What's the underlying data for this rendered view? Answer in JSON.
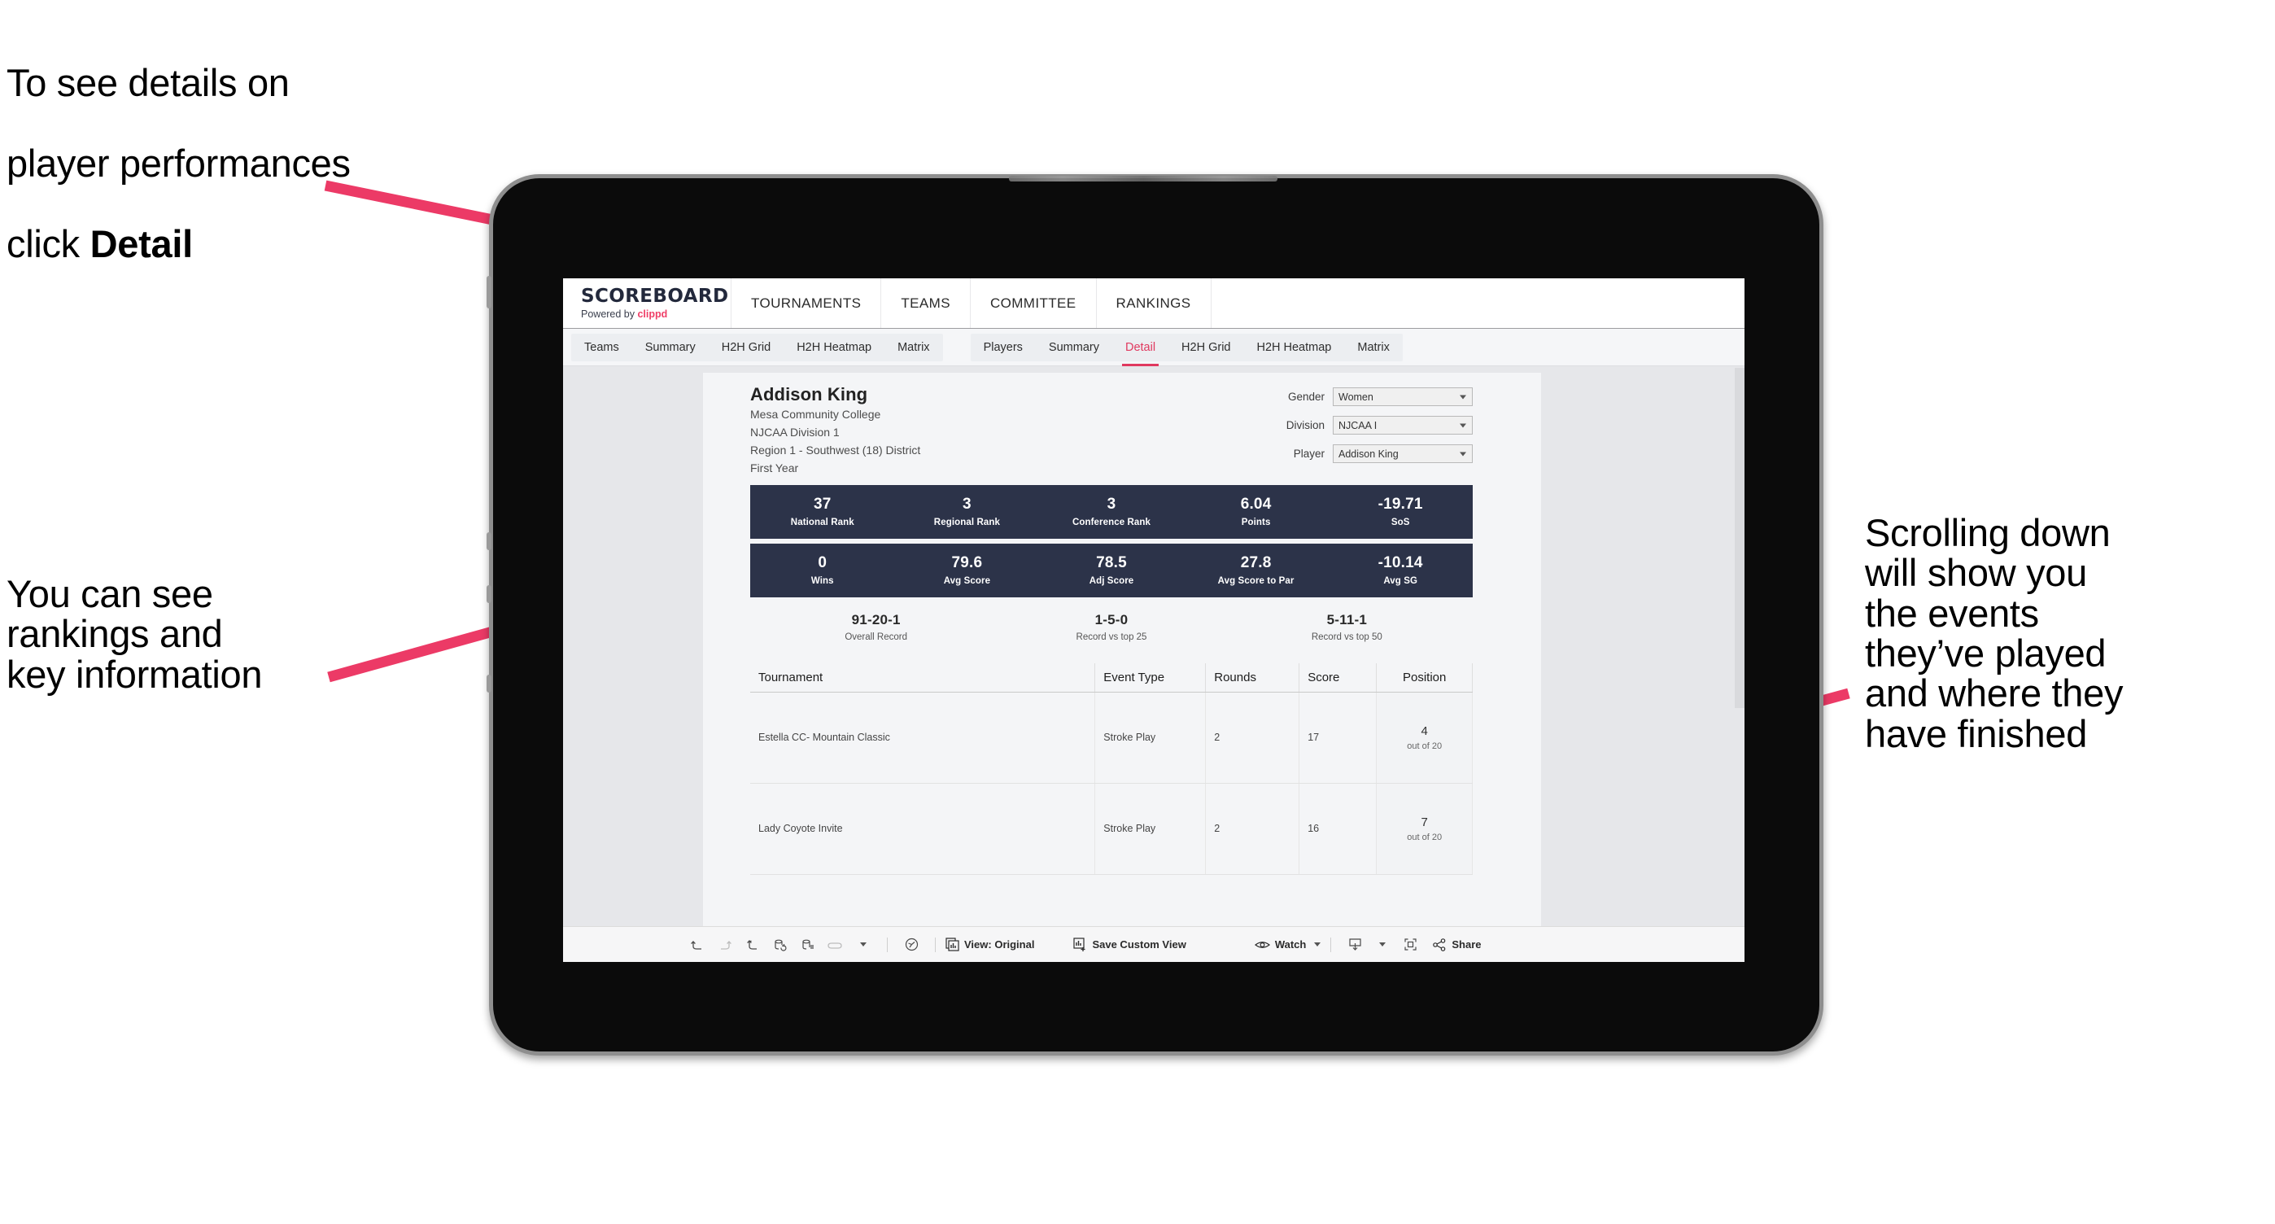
{
  "annotations": {
    "detail_note_line1": "To see details on",
    "detail_note_line2": "player performances",
    "detail_note_line3_prefix": "click ",
    "detail_note_line3_bold": "Detail",
    "rankings_note": "You can see\nrankings and\nkey information",
    "scroll_note": "Scrolling down\nwill show you\nthe events\nthey’ve played\nand where they\nhave finished",
    "accent_color": "#ec3a66"
  },
  "app": {
    "brand": {
      "title": "SCOREBOARD",
      "powered_prefix": "Powered by ",
      "powered_name": "clippd"
    },
    "top_nav": [
      "TOURNAMENTS",
      "TEAMS",
      "COMMITTEE",
      "RANKINGS"
    ],
    "tabs_group_one": [
      "Teams",
      "Summary",
      "H2H Grid",
      "H2H Heatmap",
      "Matrix"
    ],
    "tabs_group_two": [
      "Players",
      "Summary",
      "Detail",
      "H2H Grid",
      "H2H Heatmap",
      "Matrix"
    ],
    "active_tab": "Detail",
    "active_tab_color": "#e0395f"
  },
  "player": {
    "name": "Addison King",
    "school": "Mesa Community College",
    "division": "NJCAA Division 1",
    "region": "Region 1 - Southwest (18) District",
    "year": "First Year"
  },
  "filters": [
    {
      "label": "Gender",
      "value": "Women"
    },
    {
      "label": "Division",
      "value": "NJCAA I"
    },
    {
      "label": "Player",
      "value": "Addison King"
    }
  ],
  "stats_row_one": [
    {
      "value": "37",
      "label": "National Rank"
    },
    {
      "value": "3",
      "label": "Regional Rank"
    },
    {
      "value": "3",
      "label": "Conference Rank"
    },
    {
      "value": "6.04",
      "label": "Points"
    },
    {
      "value": "-19.71",
      "label": "SoS"
    }
  ],
  "stats_row_two": [
    {
      "value": "0",
      "label": "Wins"
    },
    {
      "value": "79.6",
      "label": "Avg Score"
    },
    {
      "value": "78.5",
      "label": "Adj Score"
    },
    {
      "value": "27.8",
      "label": "Avg Score to Par"
    },
    {
      "value": "-10.14",
      "label": "Avg SG"
    }
  ],
  "records": [
    {
      "value": "91-20-1",
      "label": "Overall Record"
    },
    {
      "value": "1-5-0",
      "label": "Record vs top 25"
    },
    {
      "value": "5-11-1",
      "label": "Record vs top 50"
    }
  ],
  "events_table": {
    "headers": [
      "Tournament",
      "Event Type",
      "Rounds",
      "Score",
      "Position"
    ],
    "rows": [
      {
        "tournament": "Estella CC- Mountain Classic",
        "event_type": "Stroke Play",
        "rounds": "2",
        "score": "17",
        "position": "4",
        "position_sub": "out of 20"
      },
      {
        "tournament": "Lady Coyote Invite",
        "event_type": "Stroke Play",
        "rounds": "2",
        "score": "16",
        "position": "7",
        "position_sub": "out of 20"
      }
    ]
  },
  "toolbar": {
    "view_label": "View: Original",
    "save_label": "Save Custom View",
    "watch_label": "Watch",
    "share_label": "Share"
  }
}
